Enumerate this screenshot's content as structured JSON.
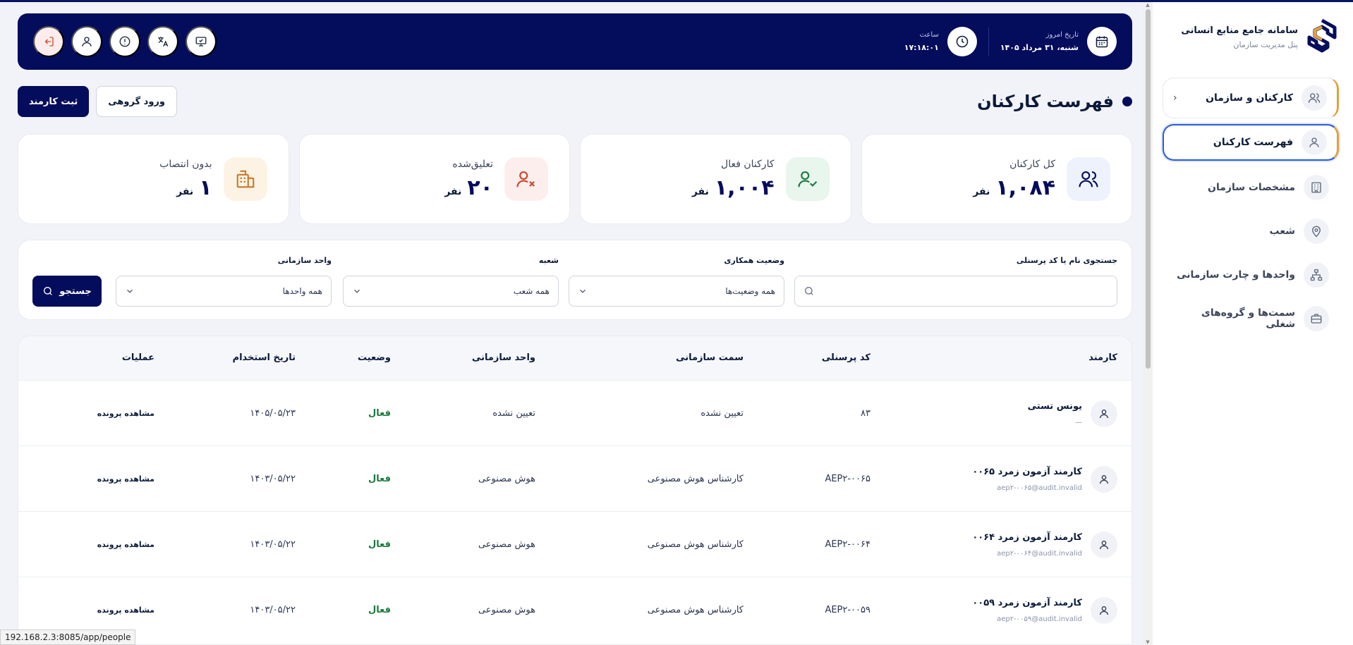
{
  "sidebar": {
    "brand_title": "سامانه جامع منابع انسانی",
    "brand_subtitle": "پنل مدیریت سازمان",
    "group_label": "کارکنان و سازمان",
    "items": [
      {
        "label": "فهرست کارکنان",
        "icon": "user-icon"
      },
      {
        "label": "مشخصات سازمان",
        "icon": "building-icon"
      },
      {
        "label": "شعب",
        "icon": "location-pin-icon"
      },
      {
        "label": "واحدها و چارت سازمانی",
        "icon": "org-chart-icon"
      },
      {
        "label": "سمت‌ها و گروه‌های شغلی",
        "icon": "briefcase-icon"
      }
    ]
  },
  "header": {
    "date_label": "تاریخ امروز",
    "date_value": "شنبه، ۳۱ مرداد ۱۴۰۵",
    "time_label": "ساعت",
    "time_value": "۱۷:۱۸:۰۱",
    "actions": [
      "monitor-icon",
      "translate-icon",
      "alert-icon",
      "profile-icon",
      "logout-icon"
    ]
  },
  "page": {
    "title": "فهرست کارکنان",
    "add_employee": "ثبت کارمند",
    "bulk_import": "ورود گروهی"
  },
  "stats": [
    {
      "label": "کل کارکنان",
      "value": "۱,۰۸۴",
      "unit": "نفر",
      "icon": "users-icon",
      "bg": "#eef2fc",
      "color": "#040c5c"
    },
    {
      "label": "کارکنان فعال",
      "value": "۱,۰۰۴",
      "unit": "نفر",
      "icon": "user-check-icon",
      "bg": "#e8f6ee",
      "color": "#1a7a3c"
    },
    {
      "label": "تعلیق‌شده",
      "value": "۲۰",
      "unit": "نفر",
      "icon": "user-x-icon",
      "bg": "#fdeeee",
      "color": "#c8452a"
    },
    {
      "label": "بدون انتصاب",
      "value": "۱",
      "unit": "نفر",
      "icon": "office-icon",
      "bg": "#fdf3e4",
      "color": "#c8782a"
    }
  ],
  "filters": {
    "search_label": "جستجوی نام یا کد پرسنلی",
    "search_placeholder": "",
    "status_label": "وضعیت همکاری",
    "status_value": "همه وضعیت‌ها",
    "branch_label": "شعبه",
    "branch_value": "همه شعب",
    "unit_label": "واحد سازمانی",
    "unit_value": "همه واحدها",
    "search_button": "جستجو"
  },
  "table": {
    "columns": [
      "کارمند",
      "کد پرسنلی",
      "سمت سازمانی",
      "واحد سازمانی",
      "وضعیت",
      "تاریخ استخدام",
      "عملیات"
    ],
    "rows": [
      {
        "name": "یونس تستی",
        "email": "—",
        "code": "۸۳",
        "position": "تعیین نشده",
        "unit": "تعیین نشده",
        "status": "فعال",
        "hire_date": "۱۴۰۵/۰۵/۲۳",
        "action": "مشاهده پرونده"
      },
      {
        "name": "کارمند آزمون زمرد ۰۰۶۵",
        "email": "aep۲-۰۰۶۵@audit.invalid",
        "code": "AEP۲-۰۰۶۵",
        "position": "کارشناس هوش مصنوعی",
        "unit": "هوش مصنوعی",
        "status": "فعال",
        "hire_date": "۱۴۰۳/۰۵/۲۲",
        "action": "مشاهده پرونده"
      },
      {
        "name": "کارمند آزمون زمرد ۰۰۶۴",
        "email": "aep۲-۰۰۶۴@audit.invalid",
        "code": "AEP۲-۰۰۶۴",
        "position": "کارشناس هوش مصنوعی",
        "unit": "هوش مصنوعی",
        "status": "فعال",
        "hire_date": "۱۴۰۳/۰۵/۲۲",
        "action": "مشاهده پرونده"
      },
      {
        "name": "کارمند آزمون زمرد ۰۰۵۹",
        "email": "aep۲-۰۰۵۹@audit.invalid",
        "code": "AEP۲-۰۰۵۹",
        "position": "کارشناس هوش مصنوعی",
        "unit": "هوش مصنوعی",
        "status": "فعال",
        "hire_date": "۱۴۰۳/۰۵/۲۲",
        "action": "مشاهده پرونده"
      }
    ]
  },
  "status_bar_url": "192.168.2.3:8085/app/people"
}
